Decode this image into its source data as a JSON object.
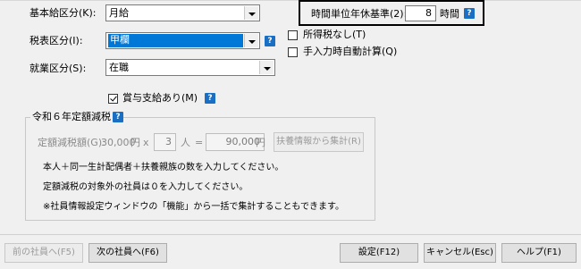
{
  "form": {
    "base_pay_label": "基本給区分(K):",
    "base_pay_value": "月給",
    "tax_table_label": "税表区分(I):",
    "tax_table_value": "甲欄",
    "employment_label": "就業区分(S):",
    "employment_value": "在職",
    "hourly_basis_label": "時間単位年休基準(2):",
    "hourly_basis_value": "8",
    "hourly_basis_unit": "時間",
    "no_income_tax_label": "所得税なし(T)",
    "manual_auto_calc_label": "手入力時自動計算(Q)",
    "bonus_label": "賞与支給あり(M)",
    "help_glyph": "?"
  },
  "reduction": {
    "group_title": "令和６年定額減税",
    "amount_label": "定額減税額(G):",
    "amount_value": "30,000",
    "yen1": "円",
    "times": "x",
    "persons_value": "3",
    "persons_unit": "人",
    "equals": "=",
    "total_value": "90,000",
    "yen2": "円",
    "aggregate_button": "扶養情報から集計(R)",
    "note1": "本人＋同一生計配偶者＋扶養親族の数を入力してください。",
    "note2": "定額減税の対象外の社員は０を入力してください。",
    "note3": "※社員情報設定ウィンドウの「機能」から一括で集計することもできます。"
  },
  "footer": {
    "prev_button": "前の社員へ(F5)",
    "next_button": "次の社員へ(F6)",
    "settings_button": "設定(F12)",
    "cancel_button": "キャンセル(Esc)",
    "help_button": "ヘルプ(F1)"
  },
  "colors": {
    "background": "#f0f0f0",
    "help_icon": "#1a6fc4",
    "selection": "#0078d7"
  }
}
